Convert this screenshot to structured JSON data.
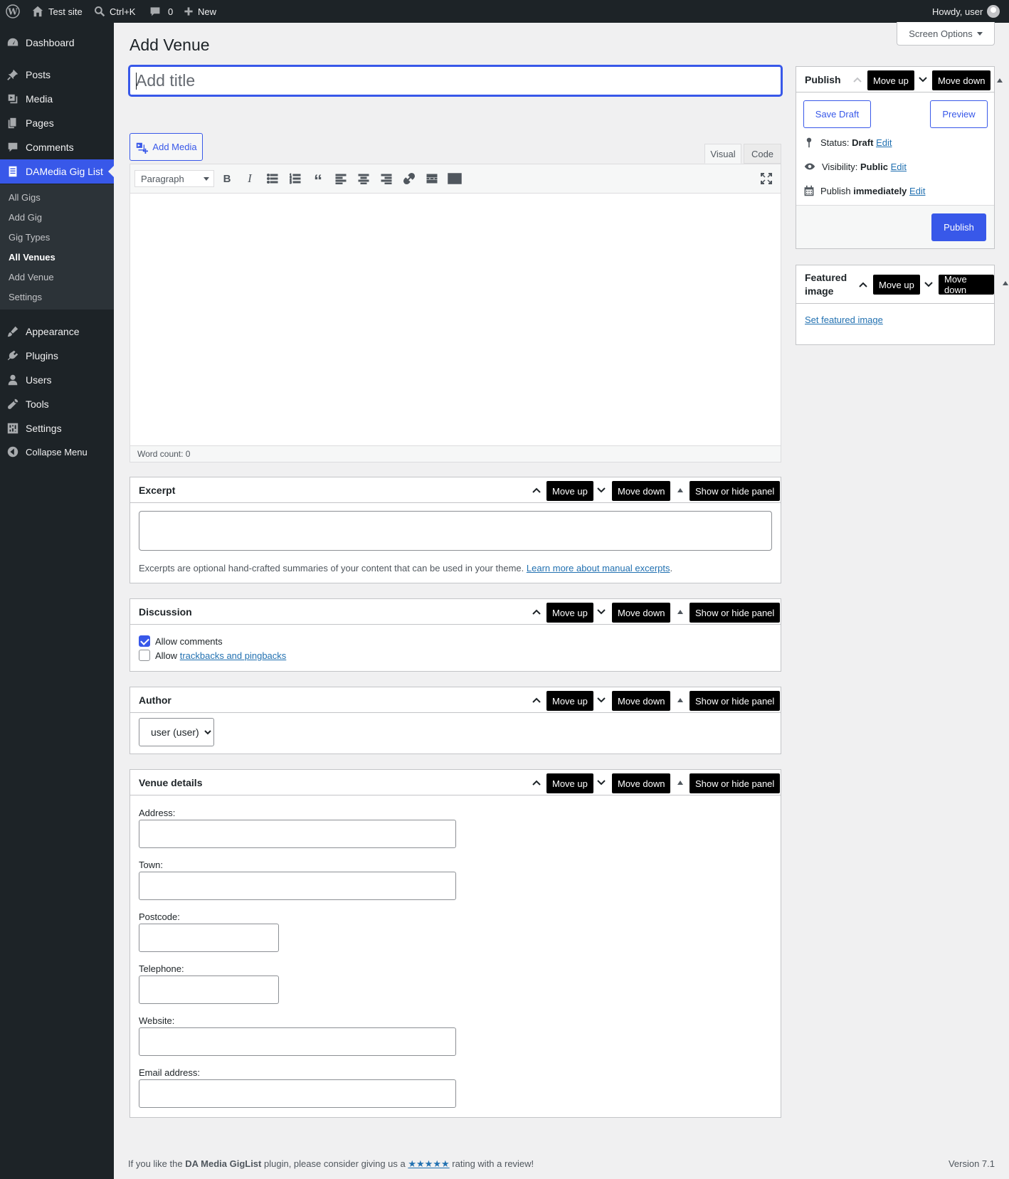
{
  "adminbar": {
    "site_name": "Test site",
    "search_shortcut": "Ctrl+K",
    "comments_count": "0",
    "new_label": "New",
    "howdy": "Howdy, user"
  },
  "sidebar": {
    "items": [
      {
        "label": "Dashboard",
        "icon": "dashboard-icon"
      },
      {
        "label": "Posts",
        "icon": "pin-icon"
      },
      {
        "label": "Media",
        "icon": "media-icon"
      },
      {
        "label": "Pages",
        "icon": "pages-icon"
      },
      {
        "label": "Comments",
        "icon": "comments-icon"
      },
      {
        "label": "DAMedia Gig List",
        "icon": "document-icon"
      },
      {
        "label": "Appearance",
        "icon": "paintbrush-icon"
      },
      {
        "label": "Plugins",
        "icon": "plugin-icon"
      },
      {
        "label": "Users",
        "icon": "users-icon"
      },
      {
        "label": "Tools",
        "icon": "wrench-icon"
      },
      {
        "label": "Settings",
        "icon": "settings-icon"
      },
      {
        "label": "Collapse Menu",
        "icon": "collapse-icon"
      }
    ],
    "submenu": [
      "All Gigs",
      "Add Gig",
      "Gig Types",
      "All Venues",
      "Add Venue",
      "Settings"
    ]
  },
  "screen_options": "Screen Options",
  "page_title": "Add Venue",
  "title_input": {
    "placeholder": "Add title",
    "value": ""
  },
  "editor": {
    "add_media": "Add Media",
    "tab_visual": "Visual",
    "tab_code": "Code",
    "format_select": "Paragraph",
    "word_count": "Word count: 0"
  },
  "panel_buttons": {
    "move_up": "Move up",
    "move_down": "Move down",
    "toggle": "Show or hide panel"
  },
  "excerpt": {
    "title": "Excerpt",
    "hint": "Excerpts are optional hand-crafted summaries of your content that can be used in your theme.",
    "link": "Learn more about manual excerpts",
    "period": "."
  },
  "discussion": {
    "title": "Discussion",
    "allow_comments": "Allow comments",
    "allow_prefix": "Allow",
    "trackbacks_link": "trackbacks and pingbacks",
    "allow_comments_checked": true,
    "trackbacks_checked": false
  },
  "author": {
    "title": "Author",
    "selected": "user (user)"
  },
  "venue": {
    "title": "Venue details",
    "fields": [
      "Address:",
      "Town:",
      "Postcode:",
      "Telephone:",
      "Website:",
      "Email address:"
    ]
  },
  "publish": {
    "title": "Publish",
    "save_draft": "Save Draft",
    "preview": "Preview",
    "status_label": "Status:",
    "status_value": "Draft",
    "visibility_label": "Visibility:",
    "visibility_value": "Public",
    "publish_label": "Publish",
    "publish_value": "immediately",
    "edit": "Edit",
    "publish_button": "Publish"
  },
  "featured": {
    "title_line1": "Featured",
    "title_line2": "image",
    "link": "Set featured image"
  },
  "footer": {
    "prefix": "If you like the",
    "plugin": "DA Media GigList",
    "middle": "plugin, please consider giving us a",
    "stars": "★★★★★",
    "suffix": "rating with a review!",
    "version": "Version 7.1"
  },
  "colors": {
    "accent": "#3858e9",
    "adminbar": "#1d2327",
    "page_bg": "#f0f0f1"
  }
}
